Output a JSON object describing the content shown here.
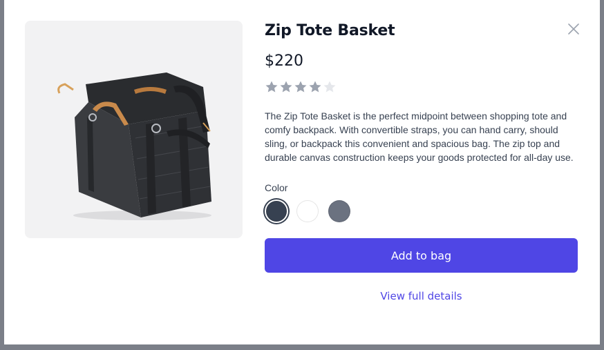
{
  "product": {
    "name": "Zip Tote Basket",
    "price": "$220",
    "rating": 4,
    "rating_max": 5,
    "image_icon": "tote-bag-image",
    "description": "The Zip Tote Basket is the perfect midpoint between shopping tote and comfy backpack. With convertible straps, you can hand carry, should sling, or backpack this convenient and spacious bag. The zip top and durable canvas construction keeps your goods protected for all-day use."
  },
  "colors": {
    "label": "Color",
    "options": [
      {
        "name": "Charcoal",
        "hex": "#374151",
        "selected": true
      },
      {
        "name": "White",
        "hex": "#ffffff",
        "selected": false
      },
      {
        "name": "Gray",
        "hex": "#6b7280",
        "selected": false
      }
    ]
  },
  "actions": {
    "add_to_bag": "Add to bag",
    "view_details": "View full details"
  },
  "theme": {
    "accent": "#4f46e5",
    "star_filled": "#9ca3af",
    "star_empty": "#e5e7eb",
    "backdrop": "#7b7f88"
  }
}
